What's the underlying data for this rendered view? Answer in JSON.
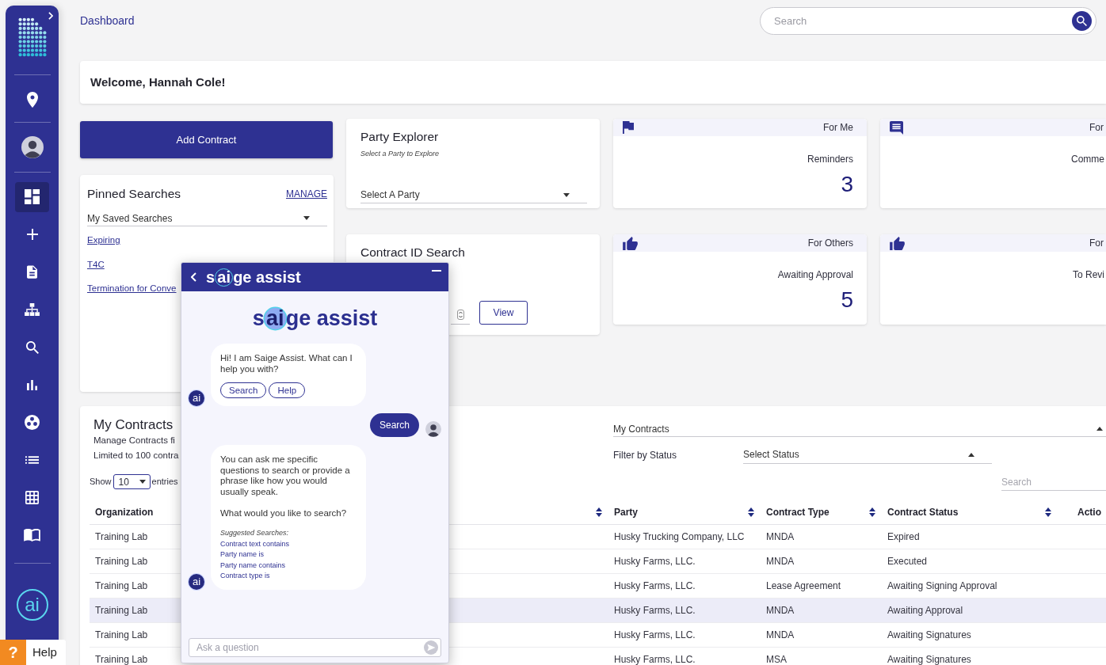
{
  "sidebar": {
    "nav": [
      {
        "selected": true
      },
      {
        "selected": false
      },
      {
        "selected": false
      },
      {
        "selected": false
      },
      {
        "selected": false
      },
      {
        "selected": false
      },
      {
        "selected": false
      },
      {
        "selected": false
      },
      {
        "selected": false
      },
      {
        "selected": false
      }
    ],
    "assistant": "ai"
  },
  "header": {
    "title": "Dashboard",
    "search": {
      "placeholder": "Search"
    }
  },
  "welcome": "Welcome, Hannah Cole!",
  "add_contract": "Add Contract",
  "pinned_searches": {
    "title": "Pinned Searches",
    "manage": "MANAGE",
    "select": "My Saved Searches",
    "links": [
      "Expiring",
      "T4C",
      "Termination for Conve"
    ]
  },
  "party_explorer": {
    "title": "Party Explorer",
    "subtitle": "Select a Party to Explore",
    "select": "Select A Party"
  },
  "contract_id_search": {
    "title": "Contract ID Search",
    "button": "View"
  },
  "stat_cards": [
    {
      "group": "For Me",
      "label": "Reminders",
      "count": "3"
    },
    {
      "group": "For",
      "label": "Comme"
    },
    {
      "group": "For Others",
      "label": "Awaiting Approval",
      "count": "5"
    },
    {
      "group": "For",
      "label": "To Revi"
    }
  ],
  "my_contracts": {
    "title": "My Contracts",
    "description": [
      "Manage Contracts fi",
      "Limited to 100 contra"
    ],
    "view_select": "My Contracts",
    "status_filter": {
      "label": "Filter by Status",
      "value": "Select Status"
    },
    "search": {
      "placeholder": "Search"
    },
    "page_size": {
      "label": "Show",
      "value": "10",
      "suffix": "entries"
    },
    "table": {
      "columns": [
        {
          "label": "Organization",
          "sortable": false
        },
        {
          "sortable": true
        },
        {
          "label": "Party",
          "sortable": true
        },
        {
          "label": "Contract Type",
          "sortable": true
        },
        {
          "label": "Contract Status",
          "sortable": true
        },
        {
          "label": "Actio",
          "sortable": false
        }
      ],
      "rows": [
        {
          "organization": "Training Lab",
          "party": "Husky Trucking Company, LLC",
          "contract_type": "MNDA",
          "contract_status": "Expired",
          "highlighted": false
        },
        {
          "organization": "Training Lab",
          "party": "Husky Farms, LLC.",
          "contract_type": "MNDA",
          "contract_status": "Executed",
          "highlighted": false
        },
        {
          "organization": "Training Lab",
          "party": "Husky Farms, LLC.",
          "contract_type": "Lease Agreement",
          "contract_status": "Awaiting Signing Approval",
          "highlighted": false
        },
        {
          "organization": "Training Lab",
          "party": "Husky Farms, LLC.",
          "contract_type": "MNDA",
          "contract_status": "Awaiting Approval",
          "highlighted": true
        },
        {
          "organization": "Training Lab",
          "party": "Husky Farms, LLC.",
          "contract_type": "MNDA",
          "contract_status": "Awaiting Signatures",
          "highlighted": false
        },
        {
          "organization": "Training Lab",
          "party": "Husky Farms, LLC.",
          "contract_type": "MSA",
          "contract_status": "Awaiting Signatures",
          "highlighted": false
        }
      ]
    }
  },
  "chat": {
    "header_logo": "s**ai**ge assist",
    "logo": "s**ai**ge assist",
    "messages": [
      {
        "kind": "bot",
        "avatar": "ai",
        "paragraphs": [
          "Hi! I am Saige Assist. What can I help you with?"
        ],
        "quick_replies": [
          "Search",
          "Help"
        ]
      },
      {
        "kind": "user",
        "text": "Search"
      },
      {
        "kind": "bot",
        "avatar": "ai",
        "paragraphs": [
          "You can ask me specific questions to search or provide a phrase like how you would usually speak.",
          "What would you like to search?"
        ],
        "suggestions_title": "Suggested Searches:",
        "suggestions": [
          "Contract text contains",
          "Party name is",
          "Party name contains",
          "Contract type is"
        ]
      }
    ],
    "input": {
      "placeholder": "Ask a question"
    }
  },
  "help": {
    "mark": "?",
    "label": "Help"
  }
}
